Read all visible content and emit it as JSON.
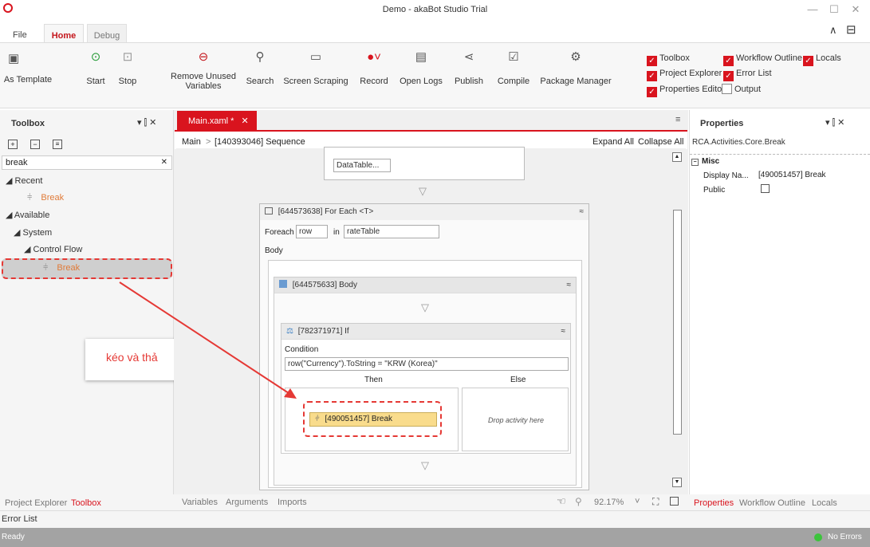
{
  "window": {
    "title": "Demo - akaBot Studio Trial",
    "minimize": "—",
    "maximize": "☐",
    "close": "✕",
    "collapse_icon": "∧",
    "layout_icon": "⊟"
  },
  "menu_tabs": {
    "file": "File",
    "home": "Home",
    "debug": "Debug"
  },
  "ribbon": {
    "as_template": "As Template",
    "start": "Start",
    "stop": "Stop",
    "remove_unused_line1": "Remove Unused",
    "remove_unused_line2": "Variables",
    "search": "Search",
    "screen_scraping": "Screen Scraping",
    "record": "Record",
    "open_logs": "Open Logs",
    "publish": "Publish",
    "compile": "Compile",
    "package_manager": "Package Manager",
    "checks": {
      "toolbox": "Toolbox",
      "workflow_outline": "Workflow Outline",
      "locals": "Locals",
      "project_explorer": "Project Explorer",
      "error_list": "Error List",
      "properties_editor": "Properties Editor",
      "output": "Output"
    }
  },
  "toolbox": {
    "title": "Toolbox",
    "pin": "▾ ⫿ ✕",
    "search_value": "break",
    "search_clear": "✕",
    "recent": "◢ Recent",
    "recent_break": "Break",
    "available": "◢ Available",
    "system": "◢ System",
    "control_flow": "◢ Control Flow",
    "cf_break": "Break"
  },
  "annotation": {
    "text": "kéo và thả"
  },
  "document": {
    "tab": "Main.xaml *",
    "tab_close": "✕",
    "breadcrumb_main": "Main",
    "breadcrumb_sep": ">",
    "breadcrumb_seq": "[140393046] Sequence",
    "expand_all": "Expand All",
    "collapse_all": "Collapse All",
    "datatable_button": "DataTable...",
    "foreach_title": "[644573638] For Each <T>",
    "foreach_label": "Foreach",
    "foreach_var": "row",
    "in_label": "in",
    "foreach_source": "rateTable",
    "body_label": "Body",
    "body_title": "[644575633] Body",
    "if_title": "[782371971] If",
    "condition_label": "Condition",
    "condition_value": "row(\"Currency\").ToString = \"KRW (Korea)\"",
    "then_label": "Then",
    "else_label": "Else",
    "break_activity": "[490051457] Break",
    "drop_here": "Drop activity here",
    "collapse_glyph": "≈",
    "arrow_down": "▽"
  },
  "bottom_tabs": {
    "variables": "Variables",
    "arguments": "Arguments",
    "imports": "Imports",
    "zoom": "92.17%",
    "zoom_arrow": "˅"
  },
  "properties": {
    "title": "Properties",
    "pin": "▾ ⫿ ✕",
    "type_name": "RCA.Activities.Core.Break",
    "group": "Misc",
    "display_name_label": "Display Na...",
    "display_name_value": "[490051457] Break",
    "public_label": "Public"
  },
  "left_bottom_tabs": {
    "project_explorer": "Project Explorer",
    "toolbox": "Toolbox"
  },
  "right_bottom_tabs": {
    "properties": "Properties",
    "workflow_outline": "Workflow Outline",
    "locals": "Locals"
  },
  "error_list": "Error List",
  "status": {
    "left": "Ready",
    "right": "No Errors"
  },
  "colors": {
    "accent": "#d9141e",
    "highlight": "#f9dc8c",
    "status_ok": "#3cc43c"
  }
}
